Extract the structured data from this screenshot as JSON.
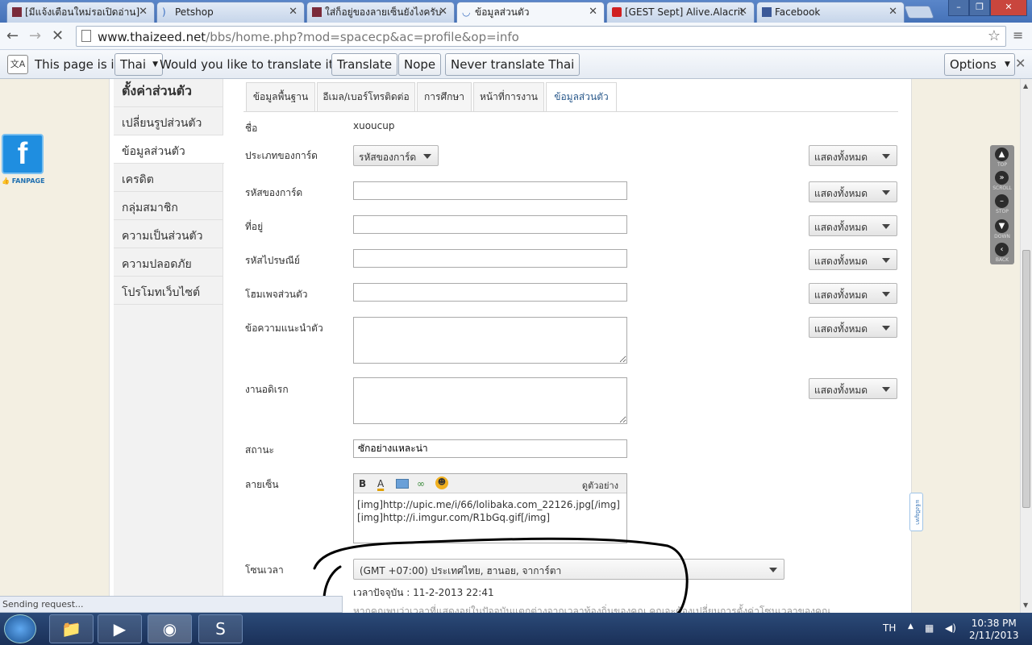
{
  "browser": {
    "tabs": [
      {
        "title": "[มีแจ้งเตือนใหม่รอเปิดอ่าน]"
      },
      {
        "title": "Petshop"
      },
      {
        "title": "ใส่ก็อยู่ของลายเซ็นยังไงครับ"
      },
      {
        "title": "ข้อมูลส่วนตัว"
      },
      {
        "title": "[GEST Sept] Alive.Alacrit"
      },
      {
        "title": "Facebook"
      }
    ],
    "url_host": "www.thaizeed.net",
    "url_path": "/bbs/home.php?mod=spacecp&ac=profile&op=info"
  },
  "translate_bar": {
    "prefix": "This page is in",
    "language": "Thai",
    "question": "Would you like to translate it?",
    "translate": "Translate",
    "nope": "Nope",
    "never": "Never translate Thai",
    "options": "Options"
  },
  "fanpage": {
    "logo": "f",
    "label": "FANPAGE"
  },
  "sidebar": {
    "title": "ตั้งค่าส่วนตัว",
    "items": [
      {
        "label": "เปลี่ยนรูปส่วนตัว"
      },
      {
        "label": "ข้อมูลส่วนตัว"
      },
      {
        "label": "เครดิต"
      },
      {
        "label": "กลุ่มสมาชิก"
      },
      {
        "label": "ความเป็นส่วนตัว"
      },
      {
        "label": "ความปลอดภัย"
      },
      {
        "label": "โปรโมทเว็บไซต์"
      }
    ]
  },
  "profile_tabs": [
    {
      "label": "ข้อมูลพื้นฐาน"
    },
    {
      "label": "อีเมล/เบอร์โทรติดต่อ"
    },
    {
      "label": "การศึกษา"
    },
    {
      "label": "หน้าที่การงาน"
    },
    {
      "label": "ข้อมูลส่วนตัว"
    }
  ],
  "form": {
    "name_label": "ชื่อ",
    "name_value": "xuoucup",
    "card_type_label": "ประเภทของการ์ด",
    "card_type_value": "รหัสของการ์ด",
    "card_code_label": "รหัสของการ์ด",
    "address_label": "ที่อยู่",
    "zip_label": "รหัสไปรษณีย์",
    "homepage_label": "โฮมเพจส่วนตัว",
    "intro_label": "ข้อความแนะนำตัว",
    "history_label": "งานอดิเรก",
    "status_label": "สถานะ",
    "status_value": "ซักอย่างแหละน่า",
    "signature_label": "ลายเซ็น",
    "signature_preview": "ดูตัวอย่าง",
    "signature_line1": "[img]http://upic.me/i/66/lolibaka.com_22126.jpg[/img]",
    "signature_line2": "[img]http://i.imgur.com/R1bGq.gif[/img]",
    "timezone_label": "โซนเวลา",
    "timezone_value": "(GMT +07:00) ประเทศไทย, ฮานอย, จาการ์ตา",
    "current_time": "เวลาปัจจุบัน : 11-2-2013 22:41",
    "time_note": "หากคุณพบว่าเวลาที่แสดงอยู่ในปัจจุบันแตกต่างจากเวลาท้องถิ่นของคุณ คุณจะต้องเปลี่ยนการตั้งค่าโซนเวลาของคุณ",
    "privacy": "แสดงทั้งหมด"
  },
  "scroll_widget": {
    "top": "TOP",
    "scroll": "SCROLL",
    "stop": "STOP",
    "down": "DOWN",
    "back": "BACK"
  },
  "side_tab": "แจ้งปัญหา",
  "status_bar": "Sending request...",
  "taskbar": {
    "lang": "TH",
    "time": "10:38 PM",
    "date": "2/11/2013"
  }
}
